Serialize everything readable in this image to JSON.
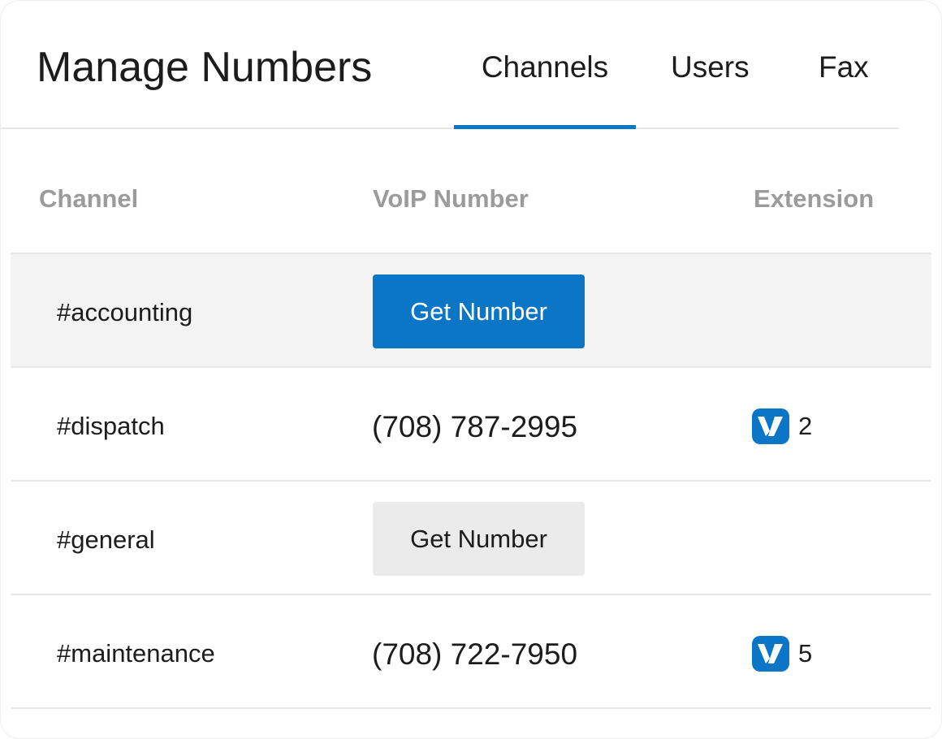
{
  "header": {
    "title": "Manage Numbers",
    "tabs": [
      {
        "label": "Channels",
        "active": true
      },
      {
        "label": "Users",
        "active": false
      },
      {
        "label": "Fax",
        "active": false
      }
    ]
  },
  "table": {
    "columns": [
      "Channel",
      "VoIP Number",
      "Extension"
    ],
    "rows": [
      {
        "channel": "#accounting",
        "button_label": "Get Number",
        "button_style": "primary"
      },
      {
        "channel": "#dispatch",
        "number": "(708) 787-2995",
        "extension": "2",
        "extension_icon": "vonage-logo-icon"
      },
      {
        "channel": "#general",
        "button_label": "Get Number",
        "button_style": "secondary"
      },
      {
        "channel": "#maintenance",
        "number": "(708) 722-7950",
        "extension": "5",
        "extension_icon": "vonage-logo-icon"
      }
    ]
  },
  "colors": {
    "accent": "#0b76c5",
    "text": "#1d1c1d",
    "muted_header": "#9b9b9b",
    "row_highlight": "#f3f3f3",
    "secondary_button": "#ebebeb"
  }
}
